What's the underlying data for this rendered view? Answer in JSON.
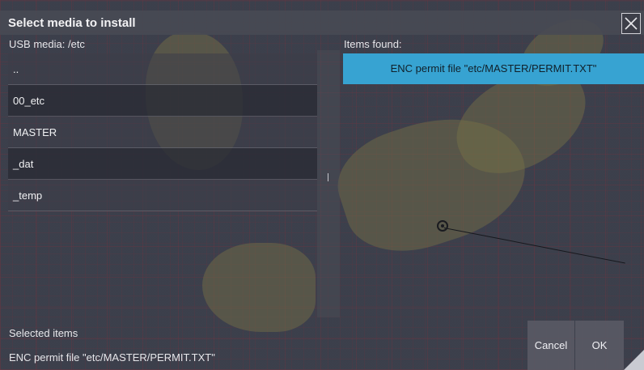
{
  "dialog": {
    "title": "Select media to install"
  },
  "media": {
    "path_label": "USB media: /etc",
    "items": [
      {
        "label": ".."
      },
      {
        "label": "00_etc"
      },
      {
        "label": "MASTER"
      },
      {
        "label": "_dat"
      },
      {
        "label": "_temp"
      }
    ]
  },
  "found": {
    "label": "Items found:",
    "items": [
      {
        "label": "ENC permit file \"etc/MASTER/PERMIT.TXT\""
      }
    ]
  },
  "selected": {
    "label": "Selected items",
    "value": "ENC permit file \"etc/MASTER/PERMIT.TXT\""
  },
  "buttons": {
    "cancel": "Cancel",
    "ok": "OK"
  },
  "colors": {
    "highlight": "#37a3d2",
    "chart_grid": "#aa2832"
  },
  "icons": {
    "close": "close-icon",
    "own_ship": "own-ship-icon",
    "resize": "resize-corner-icon"
  }
}
